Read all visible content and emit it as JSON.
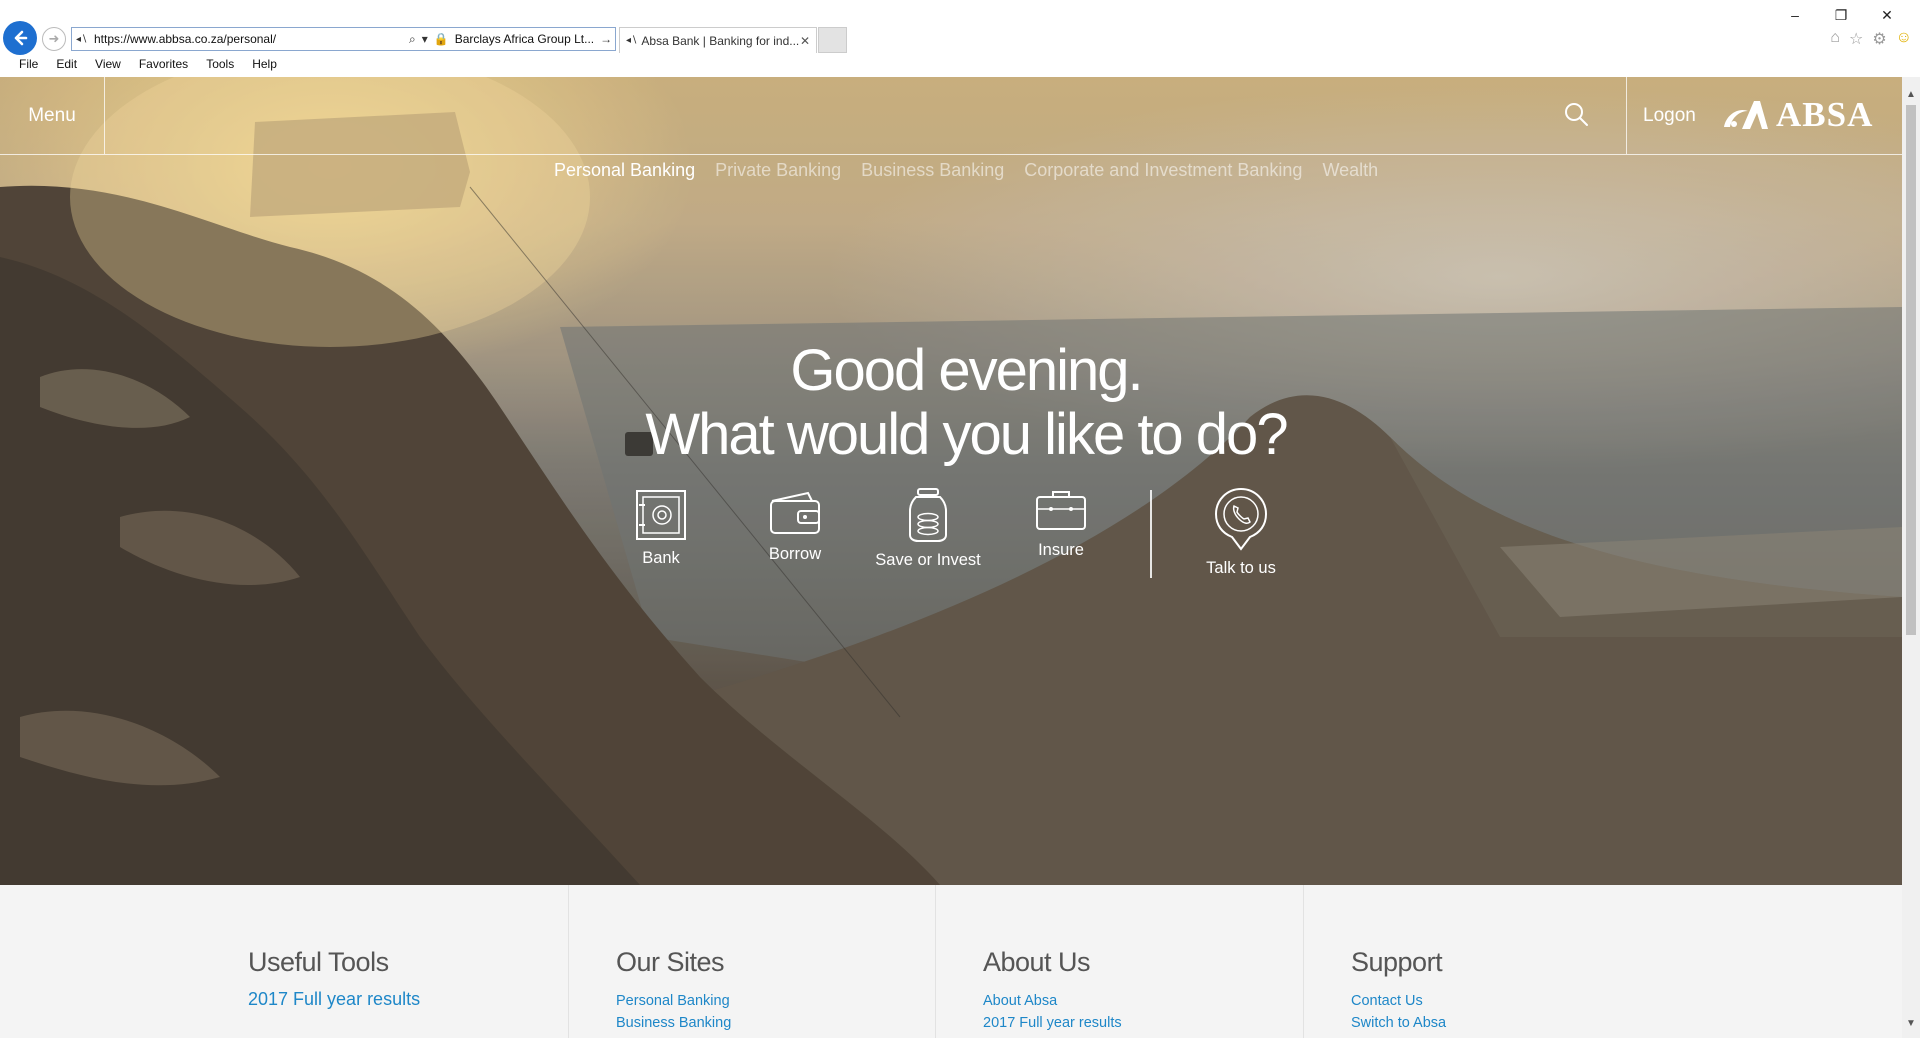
{
  "browser": {
    "url": "https://www.abbsa.co.za/personal/",
    "cert": "Barclays Africa Group Lt...",
    "tab_title": "Absa Bank | Banking for ind...",
    "menu": [
      "File",
      "Edit",
      "View",
      "Favorites",
      "Tools",
      "Help"
    ],
    "window_controls": {
      "minimize": "–",
      "restore": "❐",
      "close": "✕"
    }
  },
  "header": {
    "menu_label": "Menu",
    "logon_label": "Logon",
    "logo_text": "ABSA"
  },
  "segments": [
    {
      "label": "Personal Banking",
      "active": true
    },
    {
      "label": "Private Banking",
      "active": false
    },
    {
      "label": "Business Banking",
      "active": false
    },
    {
      "label": "Corporate and Investment Banking",
      "active": false
    },
    {
      "label": "Wealth",
      "active": false
    }
  ],
  "greeting": {
    "line1": "Good evening.",
    "line2": "What would you like to do?"
  },
  "actions": [
    {
      "label": "Bank",
      "icon": "safe-icon"
    },
    {
      "label": "Borrow",
      "icon": "wallet-icon"
    },
    {
      "label": "Save or Invest",
      "icon": "coin-jar-icon"
    },
    {
      "label": "Insure",
      "icon": "briefcase-icon"
    },
    {
      "label": "Talk to us",
      "icon": "phone-pin-icon"
    }
  ],
  "footer": {
    "useful_tools": {
      "title": "Useful Tools",
      "links": [
        "2017 Full year results"
      ]
    },
    "our_sites": {
      "title": "Our Sites",
      "links": [
        "Personal Banking",
        "Business Banking"
      ]
    },
    "about_us": {
      "title": "About Us",
      "links": [
        "About Absa",
        "2017 Full year results"
      ]
    },
    "support": {
      "title": "Support",
      "links": [
        "Contact Us",
        "Switch to Absa"
      ]
    }
  },
  "colors": {
    "link": "#1e87c8",
    "browser_back": "#1e6fd0",
    "footer_bg": "#f4f4f4"
  }
}
